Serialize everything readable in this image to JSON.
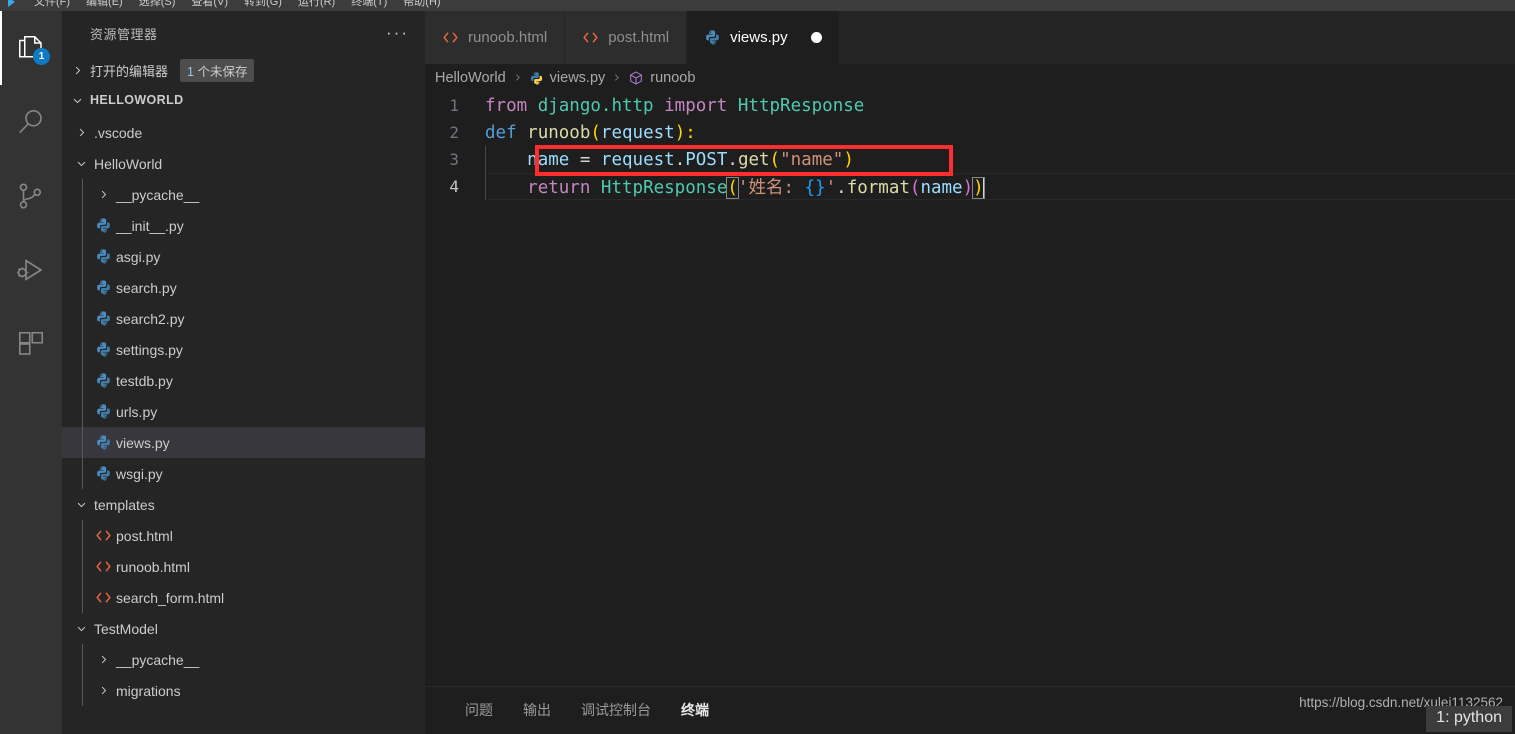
{
  "menubar": {
    "items": [
      "文件(F)",
      "编辑(E)",
      "选择(S)",
      "查看(V)",
      "转到(G)",
      "运行(R)",
      "终端(T)",
      "帮助(H)"
    ]
  },
  "activitybar": {
    "items": [
      {
        "name": "explorer-icon",
        "label": "资源管理器",
        "badge": "1",
        "active": true
      },
      {
        "name": "search-icon",
        "label": "搜索",
        "badge": "",
        "active": false
      },
      {
        "name": "source-control-icon",
        "label": "源代码管理",
        "badge": "",
        "active": false
      },
      {
        "name": "run-debug-icon",
        "label": "运行和调试",
        "badge": "",
        "active": false
      },
      {
        "name": "extensions-icon",
        "label": "扩展",
        "badge": "",
        "active": false
      }
    ]
  },
  "sidebar": {
    "title": "资源管理器",
    "more_actions": "···",
    "open_editors": {
      "label": "打开的编辑器",
      "badge_number": "1",
      "badge_text": " 个未保存"
    },
    "root": "HELLOWORLD",
    "tree": [
      {
        "label": ".vscode",
        "depth": 1,
        "type": "folder",
        "expanded": false,
        "selected": false
      },
      {
        "label": "HelloWorld",
        "depth": 1,
        "type": "folder",
        "expanded": true,
        "selected": false
      },
      {
        "label": "__pycache__",
        "depth": 2,
        "type": "folder",
        "expanded": false,
        "selected": false
      },
      {
        "label": "__init__.py",
        "depth": 2,
        "type": "python",
        "expanded": null,
        "selected": false
      },
      {
        "label": "asgi.py",
        "depth": 2,
        "type": "python",
        "expanded": null,
        "selected": false
      },
      {
        "label": "search.py",
        "depth": 2,
        "type": "python",
        "expanded": null,
        "selected": false
      },
      {
        "label": "search2.py",
        "depth": 2,
        "type": "python",
        "expanded": null,
        "selected": false
      },
      {
        "label": "settings.py",
        "depth": 2,
        "type": "python",
        "expanded": null,
        "selected": false
      },
      {
        "label": "testdb.py",
        "depth": 2,
        "type": "python",
        "expanded": null,
        "selected": false
      },
      {
        "label": "urls.py",
        "depth": 2,
        "type": "python",
        "expanded": null,
        "selected": false
      },
      {
        "label": "views.py",
        "depth": 2,
        "type": "python",
        "expanded": null,
        "selected": true
      },
      {
        "label": "wsgi.py",
        "depth": 2,
        "type": "python",
        "expanded": null,
        "selected": false
      },
      {
        "label": "templates",
        "depth": 1,
        "type": "folder",
        "expanded": true,
        "selected": false
      },
      {
        "label": "post.html",
        "depth": 2,
        "type": "html",
        "expanded": null,
        "selected": false
      },
      {
        "label": "runoob.html",
        "depth": 2,
        "type": "html",
        "expanded": null,
        "selected": false
      },
      {
        "label": "search_form.html",
        "depth": 2,
        "type": "html",
        "expanded": null,
        "selected": false
      },
      {
        "label": "TestModel",
        "depth": 1,
        "type": "folder",
        "expanded": true,
        "selected": false
      },
      {
        "label": "__pycache__",
        "depth": 2,
        "type": "folder",
        "expanded": false,
        "selected": false
      },
      {
        "label": "migrations",
        "depth": 2,
        "type": "folder",
        "expanded": false,
        "selected": false
      }
    ]
  },
  "editor": {
    "tabs": [
      {
        "label": "runoob.html",
        "icon": "html-icon",
        "active": false,
        "dirty": false
      },
      {
        "label": "post.html",
        "icon": "html-icon",
        "active": false,
        "dirty": false
      },
      {
        "label": "views.py",
        "icon": "python-icon",
        "active": true,
        "dirty": true
      }
    ],
    "breadcrumb": [
      {
        "label": "HelloWorld",
        "icon": ""
      },
      {
        "label": "views.py",
        "icon": "python-icon"
      },
      {
        "label": "runoob",
        "icon": "symbol-method-icon"
      }
    ],
    "line_numbers": [
      "1",
      "2",
      "3",
      "4"
    ],
    "code": {
      "line1": {
        "t1": "from ",
        "t2": "django.http",
        "t3": " import ",
        "t4": "HttpResponse"
      },
      "line2": {
        "t1": "def ",
        "t2": "runoob",
        "t3": "(",
        "t4": "request",
        "t5": "):"
      },
      "line3": {
        "t1": "name",
        "t2": " = ",
        "t3": "request",
        "t4": ".",
        "t5": "POST",
        "t6": ".",
        "t7": "get",
        "t8": "(",
        "t9": "\"name\"",
        "t10": ")"
      },
      "line4": {
        "t1": "return ",
        "t2": "HttpResponse",
        "t3": "(",
        "t4": "'姓名: ",
        "t5": "{}",
        "t6": "'",
        "t7": ".",
        "t8": "format",
        "t9": "(",
        "t10": "name",
        "t11": ")",
        "t12": ")"
      }
    },
    "annotation": {
      "name": "red-highlight-box",
      "color": "#ff2d2d"
    }
  },
  "panel": {
    "tabs": [
      {
        "label": "问题",
        "active": false
      },
      {
        "label": "输出",
        "active": false
      },
      {
        "label": "调试控制台",
        "active": false
      },
      {
        "label": "终端",
        "active": true
      }
    ],
    "terminal_selector": "1: python",
    "watermark": "https://blog.csdn.net/xulei1132562"
  }
}
